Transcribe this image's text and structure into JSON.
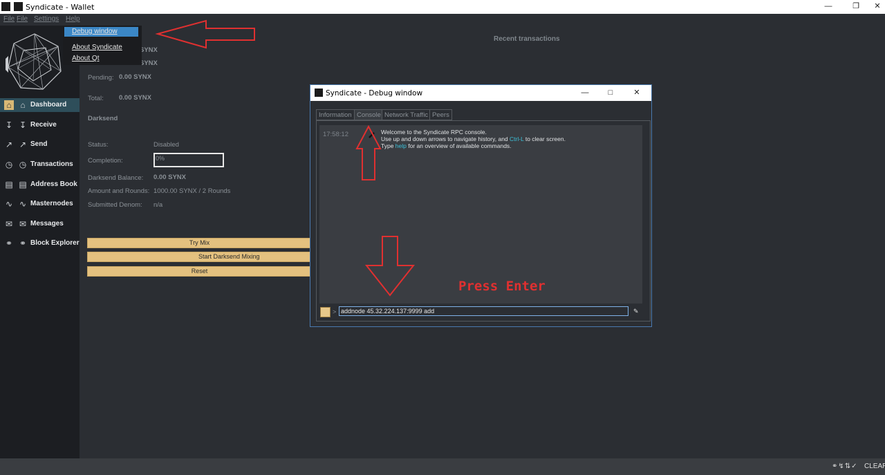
{
  "window": {
    "title": "Syndicate - Wallet",
    "controls": [
      "minimize-icon",
      "restore-icon",
      "close-icon"
    ]
  },
  "menubar": {
    "items": [
      "File",
      "File",
      "Settings",
      "Help"
    ]
  },
  "help_menu": {
    "items": [
      "Debug window",
      "About Syndicate",
      "About Qt"
    ],
    "selected": "Debug window"
  },
  "sidebar": {
    "items": [
      {
        "label": "Dashboard",
        "icon": "home-icon",
        "active": true
      },
      {
        "label": "Receive",
        "icon": "receive-icon"
      },
      {
        "label": "Send",
        "icon": "send-icon"
      },
      {
        "label": "Transactions",
        "icon": "clock-icon"
      },
      {
        "label": "Address Book",
        "icon": "address-book-icon"
      },
      {
        "label": "Masternodes",
        "icon": "masternodes-icon"
      },
      {
        "label": "Messages",
        "icon": "envelope-icon"
      },
      {
        "label": "Block Explorer",
        "icon": "globe-icon"
      }
    ]
  },
  "overview": {
    "balance_value": "SYNX",
    "unconfirmed_value": "SYNX",
    "pending_label": "Pending:",
    "pending_value": "0.00 SYNX",
    "total_label": "Total:",
    "total_value": "0.00 SYNX",
    "darksend_heading": "Darksend",
    "status_label": "Status:",
    "status_value": "Disabled",
    "completion_label": "Completion:",
    "completion_value": "0%",
    "completion_fraction": 0,
    "ds_balance_label": "Darksend Balance:",
    "ds_balance_value": "0.00 SYNX",
    "amount_rounds_label": "Amount and Rounds:",
    "amount_rounds_value": "1000.00 SYNX / 2 Rounds",
    "submitted_denom_label": "Submitted Denom:",
    "submitted_denom_value": "n/a",
    "buttons": [
      "Try Mix",
      "Start Darksend Mixing",
      "Reset"
    ],
    "recent_transactions": "Recent transactions"
  },
  "debug_window": {
    "title": "Syndicate - Debug window",
    "tabs": [
      "Information",
      "Console",
      "Network Traffic",
      "Peers"
    ],
    "active_tab": "Console",
    "console": {
      "time": "17:58:12",
      "line1": "Welcome to the Syndicate RPC console.",
      "line2_pre": "Use up and down arrows to navigate history, and ",
      "line2_link": "Ctrl-L",
      "line2_post": " to clear screen.",
      "line3_pre": "Type ",
      "line3_link": "help",
      "line3_post": " for an overview of available commands."
    },
    "prompt": ">",
    "command_value": "addnode 45.32.224.137:9999 add"
  },
  "annotation": {
    "press_enter": "Press Enter",
    "arrow_color": "#e03030"
  },
  "statusbar": {
    "text": "CLEARN"
  },
  "colors": {
    "accent_gold": "#e4c17f",
    "active_nav": "#2e4e5a",
    "selection_blue": "#3b87c6",
    "link_cyan": "#3cc0d8"
  }
}
